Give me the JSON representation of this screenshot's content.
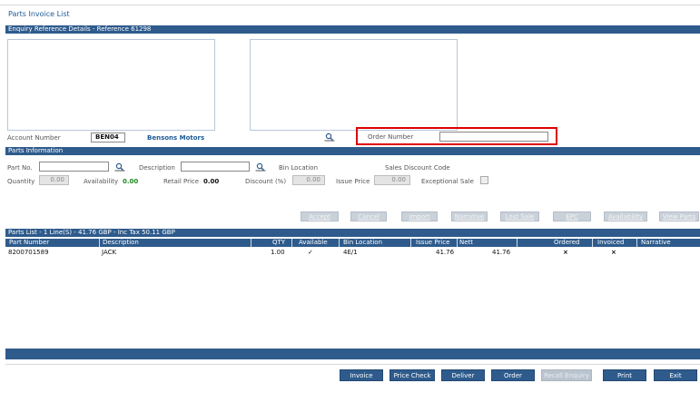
{
  "page_title": "Parts Invoice List",
  "enquiry": {
    "header": "Enquiry Reference Details - Reference 61298",
    "account_number_label": "Account Number",
    "account_number_value": "BEN04",
    "account_name": "Bensons Motors",
    "order_number_label": "Order Number",
    "order_number_value": ""
  },
  "parts_info": {
    "header": "Parts Information",
    "part_no_label": "Part No.",
    "part_no_value": "",
    "description_label": "Description",
    "description_value": "",
    "bin_location_label": "Bin Location",
    "sales_discount_label": "Sales Discount Code",
    "quantity_label": "Quantity",
    "quantity_value": "0.00",
    "availability_label": "Availability",
    "availability_value": "0.00",
    "retail_price_label": "Retail Price",
    "retail_price_value": "0.00",
    "discount_label": "Discount (%)",
    "discount_value": "0.00",
    "issue_price_label": "Issue Price",
    "issue_price_value": "0.00",
    "exceptional_sale_label": "Exceptional Sale"
  },
  "action_buttons": [
    "Accept",
    "Cancel",
    "Import",
    "Narrative",
    "Lost Sale",
    "EPC",
    "Availability",
    "View Parts"
  ],
  "parts_list": {
    "header": "Parts List - 1 Line(S) - 41.76 GBP - Inc Tax 50.11 GBP",
    "columns": [
      "Part Number",
      "Description",
      "QTY",
      "Available",
      "Bin Location",
      "Issue Price",
      "Nett",
      "Ordered",
      "Invoiced",
      "Narrative"
    ],
    "rows": [
      {
        "part_number": "8200701589",
        "description": "JACK",
        "qty": "1.00",
        "available": "✓",
        "bin_location": "4E/1",
        "issue_price": "41.76",
        "nett": "41.76",
        "ordered": "×",
        "invoiced": "×",
        "narrative": ""
      }
    ]
  },
  "footer_buttons": [
    "Invoice",
    "Price Check",
    "Deliver",
    "Order",
    "Recall Enquiry",
    "Print",
    "Exit"
  ],
  "icons": {
    "lookup": "search-lookup-icon",
    "available": "check-icon",
    "not_ordered": "cross-icon"
  },
  "colors": {
    "header_blue": "#2e5b8c",
    "title_blue": "#1a5a96",
    "highlight_red": "#e00000",
    "ok_green": "#1d8a1d"
  }
}
